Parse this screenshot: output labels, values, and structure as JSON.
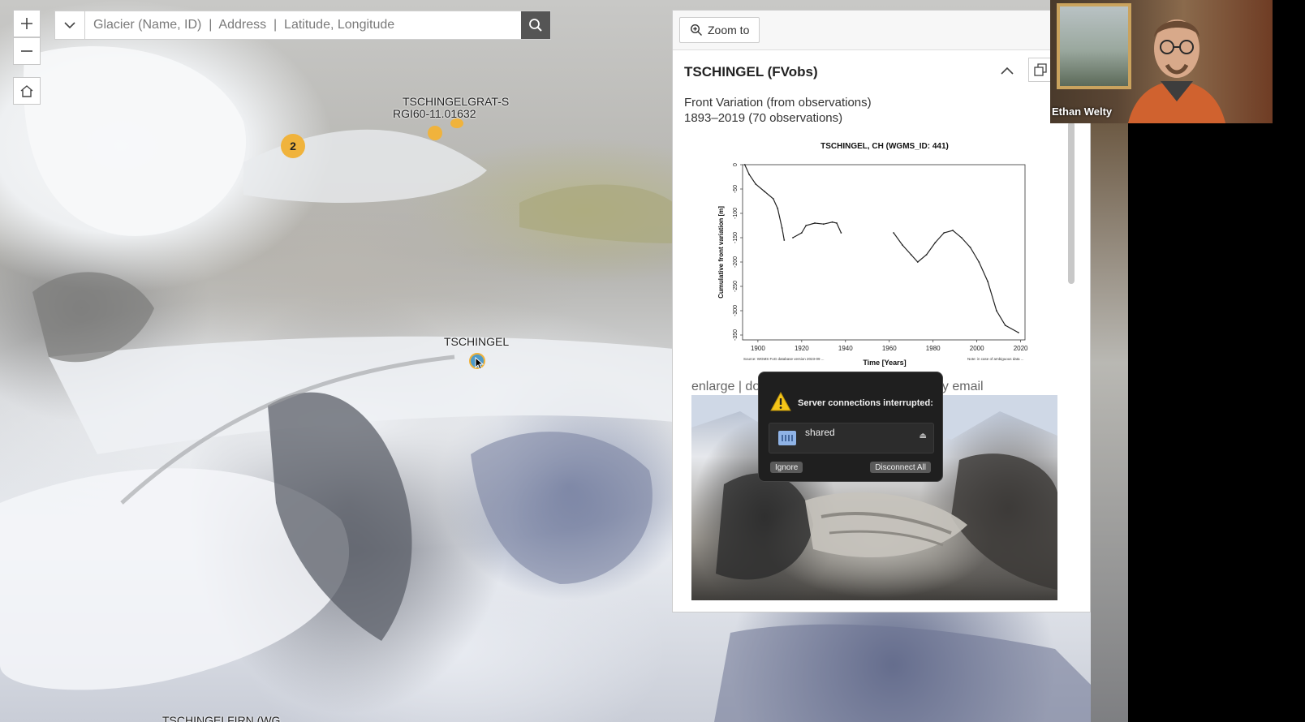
{
  "search": {
    "placeholder": "Glacier (Name, ID)  |  Address  |  Latitude, Longitude"
  },
  "map": {
    "labels": {
      "tschingelgrat": "TSCHINGELGRAT-S",
      "rgi_id": "RGI60-11.01632",
      "tschingel": "TSCHINGEL",
      "bottom": "TSCHINGELFIRN (WG…"
    },
    "cluster_count": "2"
  },
  "panel": {
    "zoom_to_label": "Zoom to",
    "title": "TSCHINGEL (FVobs)",
    "desc_line1": "Front Variation (from observations)",
    "desc_line2": "1893–2019 (70 observations)",
    "links_text": "enlarge | do",
    "links_text2": "by email"
  },
  "chart_data": {
    "type": "line",
    "title": "TSCHINGEL, CH (WGMS_ID: 441)",
    "xlabel": "Time [Years]",
    "ylabel": "Cumulative front variation [m]",
    "xlim": [
      1893,
      2022
    ],
    "ylim": [
      -360,
      0
    ],
    "xticks": [
      1900,
      1920,
      1940,
      1960,
      1980,
      2000,
      2020
    ],
    "yticks": [
      0,
      -50,
      -100,
      -150,
      -200,
      -250,
      -300,
      -350
    ],
    "footnote_left": "Source: WGMS FoG database version 2023-09 ...",
    "footnote_right": "Note: in case of ambiguous data ...",
    "segments": [
      [
        [
          1894,
          0
        ],
        [
          1896,
          -20
        ],
        [
          1899,
          -40
        ],
        [
          1903,
          -55
        ],
        [
          1907,
          -70
        ],
        [
          1909,
          -90
        ],
        [
          1911,
          -130
        ],
        [
          1912,
          -155
        ]
      ],
      [
        [
          1916,
          -150
        ],
        [
          1920,
          -140
        ],
        [
          1922,
          -125
        ],
        [
          1926,
          -120
        ],
        [
          1930,
          -122
        ],
        [
          1934,
          -118
        ],
        [
          1936,
          -120
        ],
        [
          1938,
          -140
        ]
      ],
      [
        [
          1962,
          -140
        ],
        [
          1966,
          -165
        ],
        [
          1970,
          -185
        ],
        [
          1973,
          -200
        ],
        [
          1977,
          -185
        ],
        [
          1981,
          -160
        ],
        [
          1985,
          -140
        ],
        [
          1989,
          -135
        ],
        [
          1993,
          -150
        ],
        [
          1997,
          -170
        ],
        [
          2001,
          -200
        ],
        [
          2005,
          -240
        ],
        [
          2009,
          -300
        ],
        [
          2013,
          -330
        ],
        [
          2019,
          -345
        ]
      ]
    ]
  },
  "dialog": {
    "title": "Server connections interrupted:",
    "item": "shared",
    "ignore_label": "Ignore",
    "disconnect_label": "Disconnect All"
  },
  "video": {
    "name": "Ethan Welty"
  }
}
